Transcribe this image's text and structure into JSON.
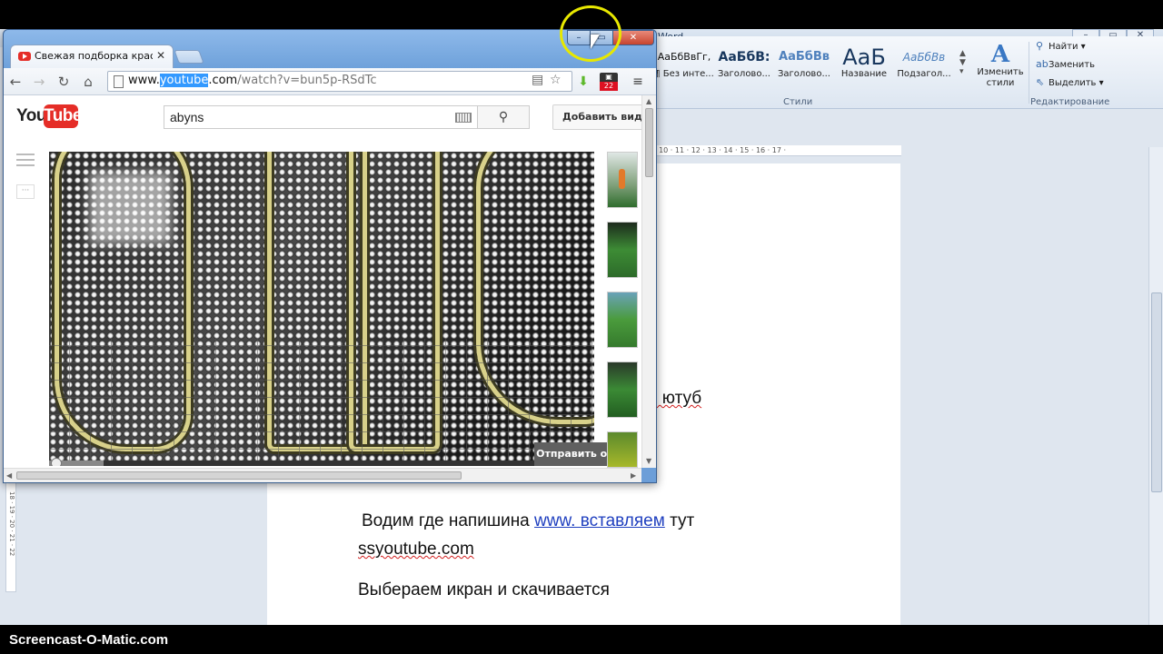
{
  "word": {
    "title_suffix": "Word",
    "ribbon": {
      "styles": [
        {
          "sample": "АаБбВвГг,",
          "name": "¶ Без инте..."
        },
        {
          "sample": "АаБбВ:",
          "name": "Заголово..."
        },
        {
          "sample": "АаБбВв",
          "name": "Заголово..."
        },
        {
          "sample": "AaБ",
          "name": "Название"
        },
        {
          "sample": "АаБбВв",
          "name": "Подзагол..."
        }
      ],
      "change_styles": "Изменить стили",
      "styles_group": "Стили",
      "editing": {
        "find": "Найти",
        "replace": "Заменить",
        "select": "Выделить",
        "group": "Редактирование"
      }
    },
    "ruler_ticks": "· 10 · 11 · 12 · 13 · 14 · 15 · 16 · 17 ·",
    "vruler_ticks": "18 · 19 · 20 · 21 · 22",
    "doc": {
      "line1_tail": "с ютуб",
      "line2_pre": "Водим где напишина",
      "line2_link": "www.  вставляем",
      "line2_post": "тут",
      "line3": "ssyoutube.com",
      "line4": "Выбераем икран и скачивается"
    }
  },
  "chrome": {
    "tab_title": "Свежая подборка красиво",
    "tab_close": "✕",
    "url": {
      "prefix": "www.",
      "highlight": "youtube",
      "suffix": ".com",
      "path": "/watch?v=bun5p-RSdTc"
    },
    "badge_count": "22",
    "youtube": {
      "logo_you": "You",
      "logo_tube": "Tube",
      "search_value": "abyns",
      "upload_label": "Добавить видео",
      "feedback_label": "Отправить отзыв"
    }
  },
  "watermark": "Screencast-O-Matic.com",
  "colors": {
    "youtube_red": "#e52d27",
    "highlight": "#e8e800",
    "link": "#1f3fbf"
  }
}
